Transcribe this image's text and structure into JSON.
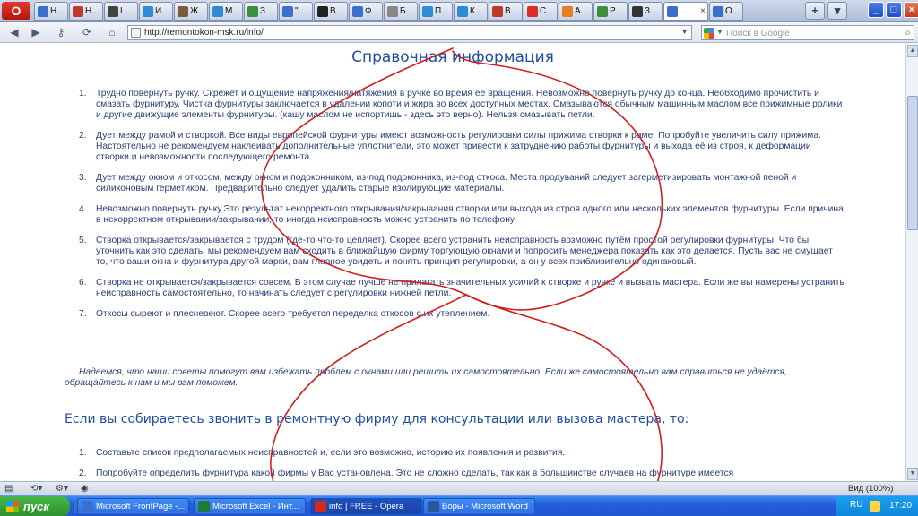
{
  "browser": {
    "logo": "O",
    "tabs": [
      {
        "label": "Н...",
        "color": "#3a6fd0"
      },
      {
        "label": "Н...",
        "color": "#c0392b"
      },
      {
        "label": "L...",
        "color": "#444444"
      },
      {
        "label": "И...",
        "color": "#2e8bd6"
      },
      {
        "label": "Ж...",
        "color": "#7a5c3a"
      },
      {
        "label": "М...",
        "color": "#2e8bd6"
      },
      {
        "label": "З...",
        "color": "#3b8f3b"
      },
      {
        "label": "\"...",
        "color": "#3a6fd0"
      },
      {
        "label": "В...",
        "color": "#222222"
      },
      {
        "label": "Ф...",
        "color": "#3a6fd0"
      },
      {
        "label": "Б...",
        "color": "#888888"
      },
      {
        "label": "П...",
        "color": "#2e8bd6"
      },
      {
        "label": "К...",
        "color": "#2e8bd6"
      },
      {
        "label": "В...",
        "color": "#c0392b"
      },
      {
        "label": "С...",
        "color": "#d93025"
      },
      {
        "label": "А...",
        "color": "#e67e22"
      },
      {
        "label": "Р...",
        "color": "#3b8f3b"
      },
      {
        "label": "З...",
        "color": "#333333"
      },
      {
        "label": "...",
        "color": "#3a6fd0",
        "active": true
      },
      {
        "label": "О...",
        "color": "#3a6fd0"
      }
    ],
    "new_tab": "+",
    "window_controls": [
      "_",
      "□",
      "×"
    ],
    "url": "http://remontokon-msk.ru/info/",
    "search_placeholder": "Поиск в Google"
  },
  "page": {
    "title": "Справочная информация",
    "tips": [
      {
        "num": "1.",
        "text": "Трудно повернуть ручку. Скрежет и ощущение напряжения/натяжения в ручке во время  её вращения. Невозможно повернуть ручку до конца. Необходимо прочистить и смазать фурнитуру. Чистка фурнитуры заключается в удалении копоти и жира во всех доступных местах. Смазываются обычным машинным маслом все прижимные ролики и другие движущие элементы фурнитуры. (кашу маслом не испортишь - здесь это верно). Нельзя смазывать петли."
      },
      {
        "num": "2.",
        "text": "Дует между рамой и створкой. Все виды европейской фурнитуры имеют возможность регулировки силы прижима створки к раме. Попробуйте увеличить силу прижима. Настоятельно не рекомендуем наклеивать дополнительные уплотнители, это может привести к затруднению работы фурнитуры и выхода её из строя, к деформации створки и невозможности последующего ремонта."
      },
      {
        "num": "3.",
        "text": "Дует между окном и откосом, между окном и подоконником, из-под подоконника, из-под откоса. Места продуваний следует загерметизировать монтажной пеной и силиконовым герметиком. Предварительно следует удалить старые изолирующие материалы."
      },
      {
        "num": "4.",
        "text": "Невозможно повернуть ручку.Это результат некорректного открывания/закрывания створки или выхода из строя одного или нескольких элементов фурнитуры. Если причина в некорректном открывании/закрывании, то иногда неисправность можно устранить по телефону."
      },
      {
        "num": "5.",
        "text": "Створка открывается/закрывается с трудом (где-то что-то цепляет). Скорее всего устранить неисправность возможно путём простой регулировки фурнитуры. Что бы уточнить как это сделать, мы рекомендуем вам сходить в ближайшую фирму торгующую окнами и попросить менеджера показать как это делается. Пусть вас не смущает то,  что ваши окна и фурнитура другой марки, вам главное увидеть и понять принцип регулировки, а он  у всех приблизительно одинаковый."
      },
      {
        "num": "6.",
        "text": "Створка не открывается/закрывается совсем. В этом случае лучше не прилагать значительных усилий к створке и ручке и вызвать мастера. Если же вы намерены устранить неисправность самостоятельно, то начинать следует с регулировки нижней петли."
      },
      {
        "num": "7.",
        "text": "Откосы сыреют и плесневеют. Скорее всего требуется переделка откосов с их утеплением."
      }
    ],
    "closing": "Надеемся, что наши советы помогут вам избежать проблем с окнами или решить их самостоятельно. Если же самостоятельно вам справиться не удаётся, обращайтесь к нам и мы вам поможем.",
    "subheading": "Если вы собираетесь звонить в ремонтную фирму для консультации или вызова мастера, то:",
    "steps": [
      {
        "num": "1.",
        "text": "Составьте список предполагаемых неисправностей и, если это возможно, историю их появления и развития."
      },
      {
        "num": "2.",
        "text": "Попробуйте определить  фурнитура какой фирмы у Вас установлена. Это не сложно сделать, так как в большинстве случаев на фурнитуре имеется"
      }
    ]
  },
  "statusbar": {
    "zoom": "Вид (100%)"
  },
  "taskbar": {
    "start": "пуск",
    "tasks": [
      {
        "label": "Microsoft FrontPage -...",
        "color": "#3a6fd0"
      },
      {
        "label": "Microsoft Excel - Инт...",
        "color": "#1d7a3a"
      },
      {
        "label": "info | FREE - Opera",
        "color": "#d6281d",
        "active": true
      },
      {
        "label": "Воры - Microsoft Word",
        "color": "#2b579a"
      }
    ],
    "lang": "RU",
    "clock": "17:20"
  },
  "colors": {
    "scribble": "#d21e1e",
    "link_text": "#2b3f78",
    "heading": "#1f4ea1"
  }
}
